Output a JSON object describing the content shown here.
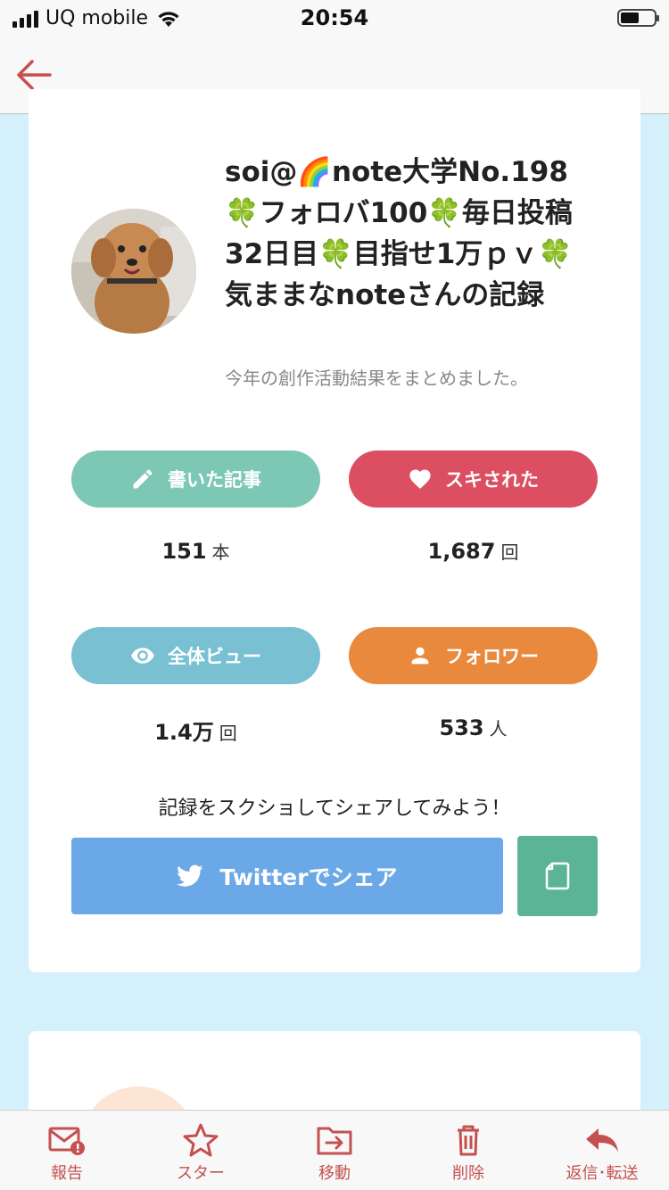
{
  "status_bar": {
    "carrier": "UQ mobile",
    "time": "20:54"
  },
  "nav": {
    "back_icon": "arrow-left-icon"
  },
  "profile": {
    "title": "soi@🌈note大学No.198🍀フォロバ100🍀毎日投稿32日目🍀目指せ1万ｐｖ🍀気ままなnoteさんの記録",
    "subtitle": "今年の創作活動結果をまとめました。"
  },
  "stats": [
    {
      "label": "書いた記事",
      "icon": "pencil-icon",
      "value": "151",
      "unit": "本",
      "color": "#7cc8b4"
    },
    {
      "label": "スキされた",
      "icon": "heart-icon",
      "value": "1,687",
      "unit": "回",
      "color": "#dc4f62"
    },
    {
      "label": "全体ビュー",
      "icon": "eye-icon",
      "value": "1.4万",
      "unit": "回",
      "color": "#79c0d3"
    },
    {
      "label": "フォロワー",
      "icon": "person-icon",
      "value": "533",
      "unit": "人",
      "color": "#e8893d"
    }
  ],
  "share": {
    "prompt": "記録をスクショしてシェアしてみよう！",
    "twitter_label": "Twitterでシェア"
  },
  "tabbar": [
    {
      "label": "報告",
      "icon": "report-mail-icon"
    },
    {
      "label": "スター",
      "icon": "star-icon"
    },
    {
      "label": "移動",
      "icon": "move-folder-icon"
    },
    {
      "label": "削除",
      "icon": "trash-icon"
    },
    {
      "label": "返信･転送",
      "icon": "reply-icon"
    }
  ],
  "colors": {
    "background": "#d4f1fb",
    "accent_red": "#c55050",
    "twitter_blue": "#6aa8e8",
    "copy_green": "#5cb496"
  }
}
